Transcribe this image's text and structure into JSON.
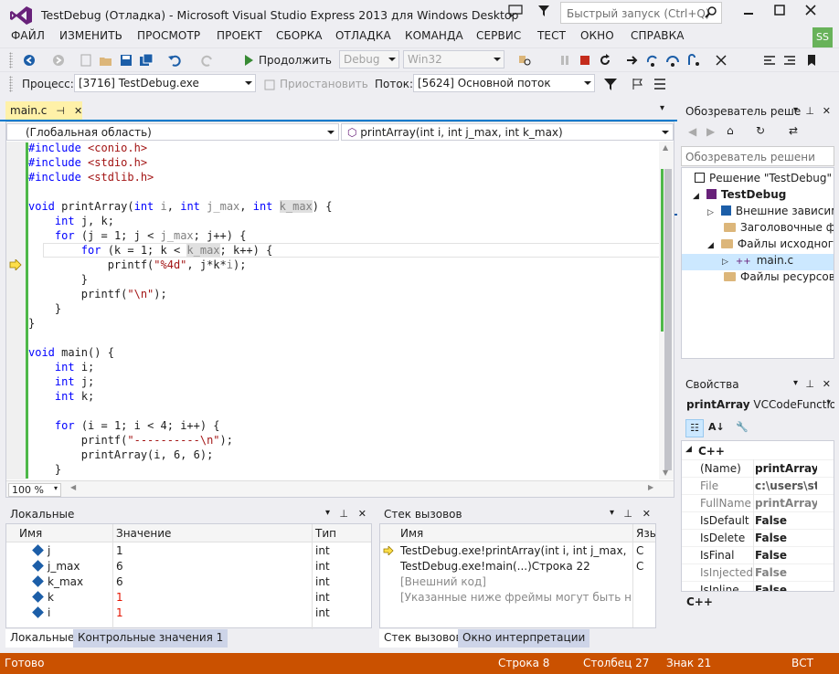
{
  "window": {
    "title": "TestDebug (Отладка) - Microsoft Visual Studio Express 2013 для Windows Desktop",
    "quick_launch_placeholder": "Быстрый запуск (Ctrl+Q)",
    "user_initials": "SS"
  },
  "menu": [
    "ФАЙЛ",
    "ИЗМЕНИТЬ",
    "ПРОСМОТР",
    "ПРОЕКТ",
    "СБОРКА",
    "ОТЛАДКА",
    "КОМАНДА",
    "СЕРВИС",
    "ТЕСТ",
    "ОКНО",
    "СПРАВКА"
  ],
  "toolbar": {
    "continue_label": "Продолжить",
    "config": "Debug",
    "platform": "Win32"
  },
  "debug_bar": {
    "process_label": "Процесс:",
    "process_value": "[3716] TestDebug.exe",
    "suspend_label": "Приостановить",
    "thread_label": "Поток:",
    "thread_value": "[5624] Основной поток"
  },
  "editor": {
    "tab": "main.c",
    "scope": "(Глобальная область)",
    "function": "printArray(int i, int j_max, int k_max)",
    "zoom": "100 %",
    "lines": [
      "#include <conio.h>",
      "#include <stdio.h>",
      "#include <stdlib.h>",
      "",
      "void printArray(int i, int j_max, int k_max) {",
      "    int j, k;",
      "    for (j = 1; j < j_max; j++) {",
      "        for (k = 1; k < k_max; k++) {",
      "            printf(\"%4d\", j*k*i);",
      "        }",
      "        printf(\"\\n\");",
      "    }",
      "}",
      "",
      "void main() {",
      "    int i;",
      "    int j;",
      "    int k;",
      "",
      "    for (i = 1; i < 4; i++) {",
      "        printf(\"----------\\n\");",
      "        printArray(i, 6, 6);",
      "    }"
    ]
  },
  "locals": {
    "title": "Локальные",
    "columns": [
      "Имя",
      "Значение",
      "Тип"
    ],
    "rows": [
      {
        "name": "j",
        "value": "1",
        "type": "int"
      },
      {
        "name": "j_max",
        "value": "6",
        "type": "int"
      },
      {
        "name": "k_max",
        "value": "6",
        "type": "int"
      },
      {
        "name": "k",
        "value": "1",
        "type": "int"
      },
      {
        "name": "i",
        "value": "1",
        "type": "int"
      }
    ],
    "tabs": [
      "Локальные",
      "Контрольные значения 1"
    ]
  },
  "callstack": {
    "title": "Стек вызовов",
    "columns": [
      "Имя",
      "Язы"
    ],
    "rows": [
      {
        "name": "TestDebug.exe!printArray(int i, int j_max, int k_m",
        "lang": "C"
      },
      {
        "name": "TestDebug.exe!main(...)Строка 22",
        "lang": "C"
      },
      {
        "name": "[Внешний код]",
        "lang": ""
      },
      {
        "name": "[Указанные ниже фреймы могут быть неверн",
        "lang": ""
      }
    ],
    "tabs": [
      "Стек вызовов",
      "Окно интерпретации"
    ]
  },
  "solution_explorer": {
    "title": "Обозреватель реше",
    "search_placeholder": "Обозреватель решени",
    "items": [
      "Решение \"TestDebug\"  (п",
      "TestDebug",
      "Внешние зависим",
      "Заголовочные фа",
      "Файлы исходного",
      "main.c",
      "Файлы ресурсов"
    ]
  },
  "properties": {
    "title": "Свойства",
    "object": "printArray",
    "object_type": "VCCodeFunctio",
    "category": "C++",
    "rows": [
      {
        "name": "(Name)",
        "value": "printArray"
      },
      {
        "name": "File",
        "value": "c:\\users\\step"
      },
      {
        "name": "FullName",
        "value": "printArray"
      },
      {
        "name": "IsDefault",
        "value": "False"
      },
      {
        "name": "IsDelete",
        "value": "False"
      },
      {
        "name": "IsFinal",
        "value": "False"
      },
      {
        "name": "IsInjected",
        "value": "False"
      },
      {
        "name": "IsInline",
        "value": "False"
      }
    ],
    "description": "C++"
  },
  "status": {
    "ready": "Готово",
    "line": "Строка 8",
    "column": "Столбец 27",
    "char": "Знак 21",
    "mode": "ВСТ"
  },
  "colors": {
    "accent": "#007acc",
    "status_debug": "#ca5100",
    "vs_purple": "#68217a"
  }
}
